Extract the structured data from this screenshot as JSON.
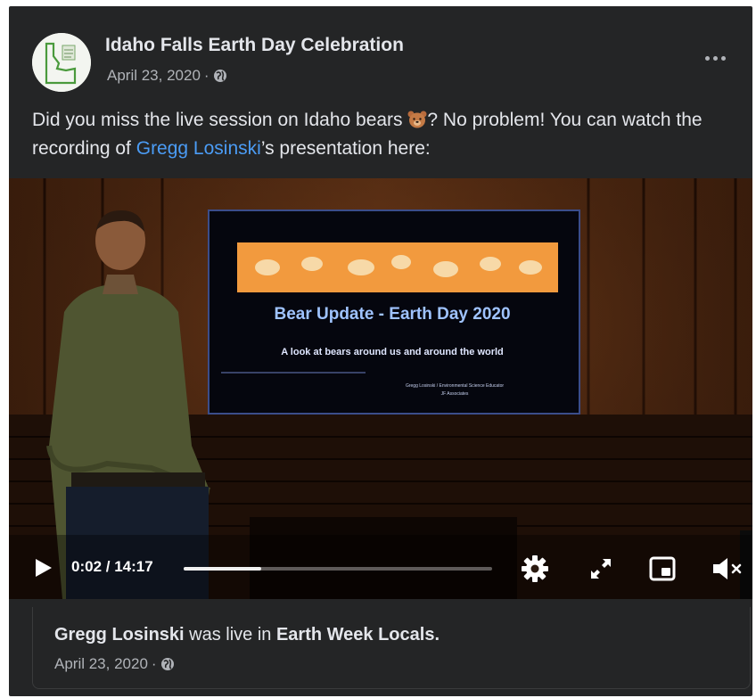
{
  "post": {
    "page_name": "Idaho Falls Earth Day Celebration",
    "date": "April 23, 2020",
    "separator": "·",
    "privacy_icon": "globe-icon",
    "more_icon": "more-options-icon",
    "text_part1": "Did you miss the live session on Idaho bears ",
    "emoji": "bear-face-emoji",
    "text_part2": "? No problem! You can watch the recording of ",
    "mention": "Gregg Losinski",
    "text_part3": "’s presentation here:"
  },
  "video": {
    "slide_title": "Bear Update - Earth Day 2020",
    "slide_subtitle": "A look at bears around us and around the world",
    "slide_credit_1": "Gregg Losinski / Environmental Science Educator",
    "slide_credit_2": "JF Associates",
    "current_time": "0:02",
    "time_separator": " / ",
    "duration": "14:17",
    "progress_fraction": 0.25,
    "icons": [
      "play-icon",
      "settings-gear-icon",
      "fullscreen-icon",
      "picture-in-picture-icon",
      "muted-volume-icon"
    ]
  },
  "shared": {
    "actor": "Gregg Losinski",
    "action": " was live in ",
    "group": "Earth Week Locals.",
    "date": "April 23, 2020",
    "separator": "·",
    "privacy_icon": "globe-icon"
  },
  "colors": {
    "card_bg": "#242526",
    "link": "#4b9cf5",
    "secondary_text": "#b0b3b8"
  }
}
